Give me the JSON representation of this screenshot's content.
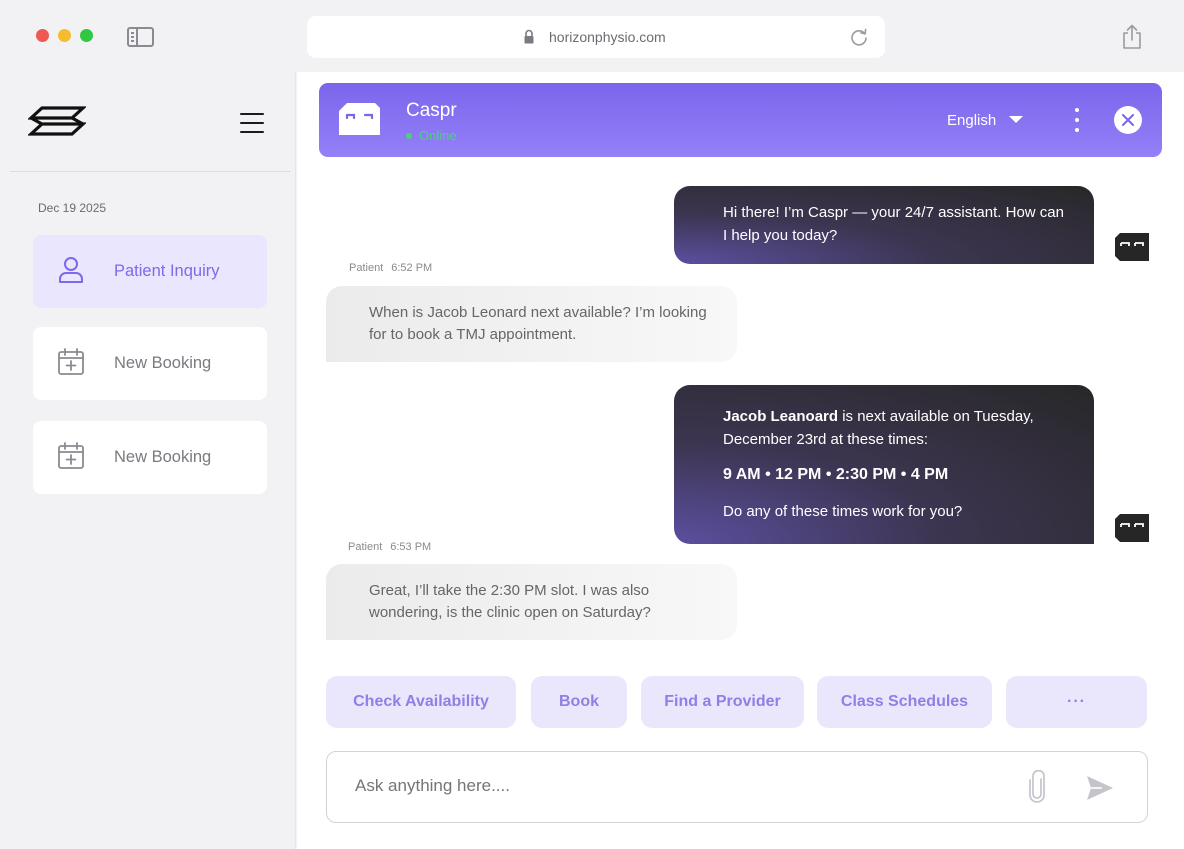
{
  "browser": {
    "url": "horizonphysio.com"
  },
  "sidebar": {
    "date": "Dec 19 2025",
    "items": [
      {
        "label": "Patient Inquiry",
        "icon": "user-icon",
        "active": true
      },
      {
        "label": "New Booking",
        "icon": "calendar-plus-icon",
        "active": false
      },
      {
        "label": "New Booking",
        "icon": "calendar-plus-icon",
        "active": false
      }
    ]
  },
  "chat": {
    "bot_name": "Caspr",
    "status": "Online",
    "language": "English",
    "messages": [
      {
        "from": "bot",
        "text": "Hi there! I’m Caspr — your 24/7 assistant. How can I help you today?"
      },
      {
        "from": "user",
        "sender": "Patient",
        "time": "6:52 PM",
        "text": "When is Jacob Leonard next available? I’m looking for to book a TMJ appointment."
      },
      {
        "from": "bot",
        "name_bold": "Jacob Leanoard",
        "text_rest": " is next available on Tuesday, December 23rd at these times:",
        "times": "9 AM • 12 PM • 2:30 PM • 4 PM",
        "question": "Do any of these times work for you?"
      },
      {
        "from": "user",
        "sender": "Patient",
        "time": "6:53 PM",
        "text": "Great, I’ll take the 2:30 PM slot. I was also wondering, is the clinic open on Saturday?"
      }
    ],
    "quick_actions": [
      "Check Availability",
      "Book",
      "Find a Provider",
      "Class Schedules",
      "···"
    ],
    "composer_placeholder": "Ask anything here...."
  },
  "colors": {
    "accent": "#7c6ae8",
    "header_gradient_start": "#7b66ec",
    "header_gradient_end": "#9480f7",
    "quick_action_bg": "#eae7fd",
    "online": "#4ad27a",
    "bot_bubble": "#272727"
  }
}
